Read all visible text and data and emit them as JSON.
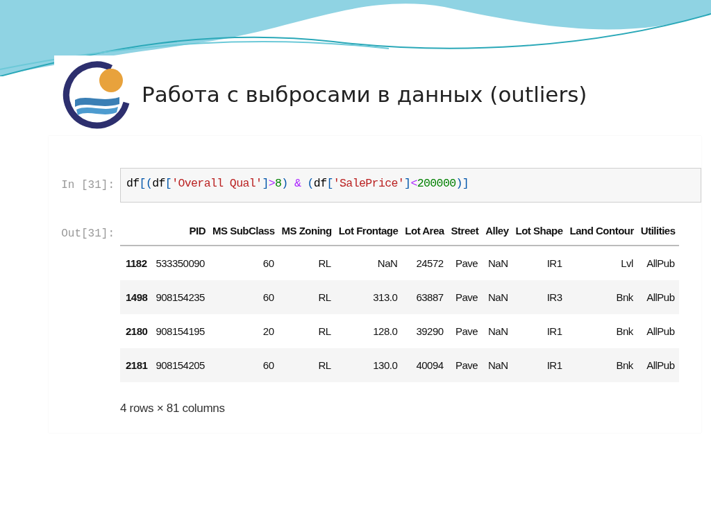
{
  "slide_title": "Работа с выбросами в данных (outliers)",
  "input_cell": {
    "prompt": "In [31]:",
    "code_tokens": [
      {
        "text": "df",
        "kind": "name"
      },
      {
        "text": "[(",
        "kind": "punct"
      },
      {
        "text": "df",
        "kind": "name"
      },
      {
        "text": "[",
        "kind": "punct"
      },
      {
        "text": "'Overall Qual'",
        "kind": "string"
      },
      {
        "text": "]",
        "kind": "punct"
      },
      {
        "text": ">",
        "kind": "operator"
      },
      {
        "text": "8",
        "kind": "number"
      },
      {
        "text": ") ",
        "kind": "punct"
      },
      {
        "text": "&",
        "kind": "operator"
      },
      {
        "text": " (",
        "kind": "punct"
      },
      {
        "text": "df",
        "kind": "name"
      },
      {
        "text": "[",
        "kind": "punct"
      },
      {
        "text": "'SalePrice'",
        "kind": "string"
      },
      {
        "text": "]",
        "kind": "punct"
      },
      {
        "text": "<",
        "kind": "operator"
      },
      {
        "text": "200000",
        "kind": "number"
      },
      {
        "text": ")]",
        "kind": "punct"
      }
    ]
  },
  "output_cell": {
    "prompt": "Out[31]:",
    "table": {
      "columns": [
        "PID",
        "MS SubClass",
        "MS Zoning",
        "Lot Frontage",
        "Lot Area",
        "Street",
        "Alley",
        "Lot Shape",
        "Land Contour",
        "Utilities"
      ],
      "rows": [
        {
          "index": "1182",
          "cells": [
            "533350090",
            "60",
            "RL",
            "NaN",
            "24572",
            "Pave",
            "NaN",
            "IR1",
            "Lvl",
            "AllPub"
          ]
        },
        {
          "index": "1498",
          "cells": [
            "908154235",
            "60",
            "RL",
            "313.0",
            "63887",
            "Pave",
            "NaN",
            "IR3",
            "Bnk",
            "AllPub"
          ]
        },
        {
          "index": "2180",
          "cells": [
            "908154195",
            "20",
            "RL",
            "128.0",
            "39290",
            "Pave",
            "NaN",
            "IR1",
            "Bnk",
            "AllPub"
          ]
        },
        {
          "index": "2181",
          "cells": [
            "908154205",
            "60",
            "RL",
            "130.0",
            "40094",
            "Pave",
            "NaN",
            "IR1",
            "Bnk",
            "AllPub"
          ]
        }
      ]
    },
    "footer": "4 rows × 81 columns"
  }
}
